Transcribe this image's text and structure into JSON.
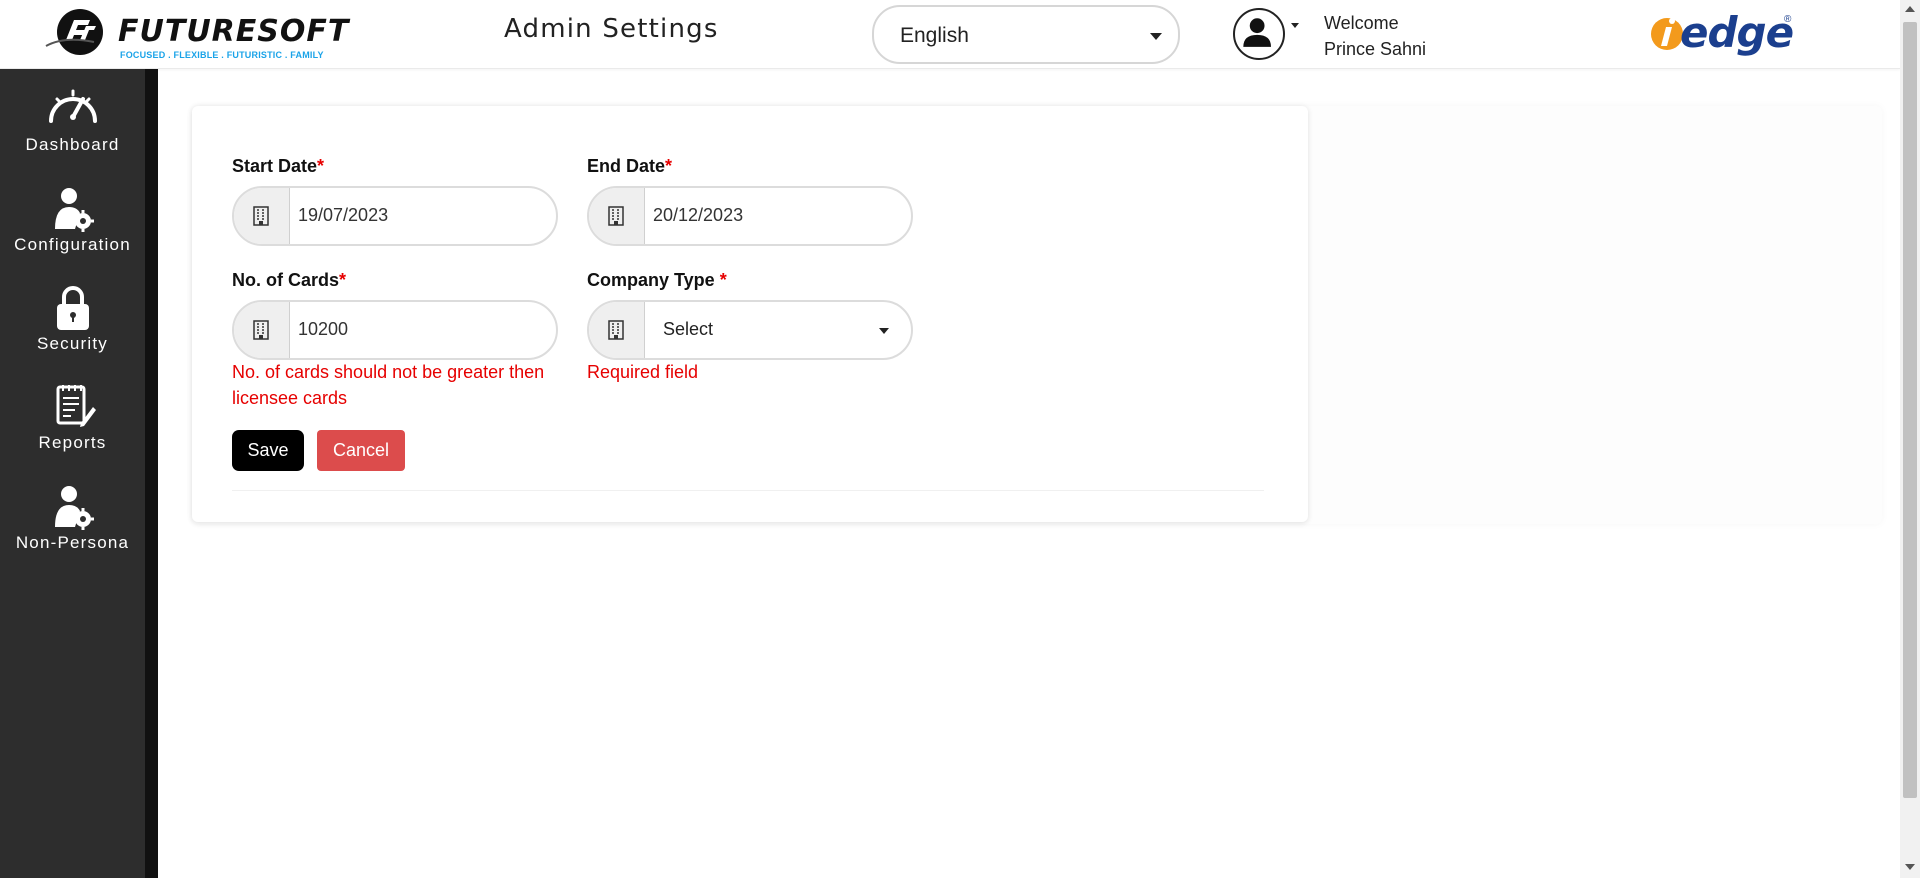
{
  "header": {
    "logo_word": "FUTURESOFT",
    "logo_tagline": "FOCUSED . FLEXIBLE . FUTURISTIC . FAMILY",
    "page_title": "Admin Settings",
    "language": "English",
    "welcome_label": "Welcome",
    "user_name": "Prince Sahni",
    "brand_word": "edge",
    "brand_reg": "®"
  },
  "sidebar": {
    "items": [
      {
        "label": "Dashboard",
        "icon": "dashboard-gauge-icon"
      },
      {
        "label": "Configuration",
        "icon": "user-gear-icon"
      },
      {
        "label": "Security",
        "icon": "lock-icon"
      },
      {
        "label": "Reports",
        "icon": "report-edit-icon"
      },
      {
        "label": "Non-Persona",
        "icon": "user-gear-icon"
      }
    ]
  },
  "form": {
    "start_date": {
      "label": "Start Date",
      "required_mark": "*",
      "value": "19/07/2023",
      "icon": "building-icon"
    },
    "end_date": {
      "label": "End Date",
      "required_mark": "*",
      "value": "20/12/2023",
      "icon": "building-icon"
    },
    "cards": {
      "label": "No. of Cards",
      "required_mark": "*",
      "value": "10200",
      "icon": "building-icon",
      "error_line1": "No. of cards should not be greater then",
      "error_line2": "licensee cards"
    },
    "company_type": {
      "label": "Company Type ",
      "required_mark": "*",
      "value": "Select",
      "icon": "building-icon",
      "error": "Required field"
    },
    "save_label": "Save",
    "cancel_label": "Cancel"
  },
  "colors": {
    "sidebar_bg": "#2d2d2d",
    "error": "#e60000",
    "save_bg": "#000000",
    "cancel_bg": "#dc4c4c",
    "brand_blue": "#1b3f8e",
    "brand_orange": "#f39a1c",
    "tagline_blue": "#1aa3e8"
  }
}
